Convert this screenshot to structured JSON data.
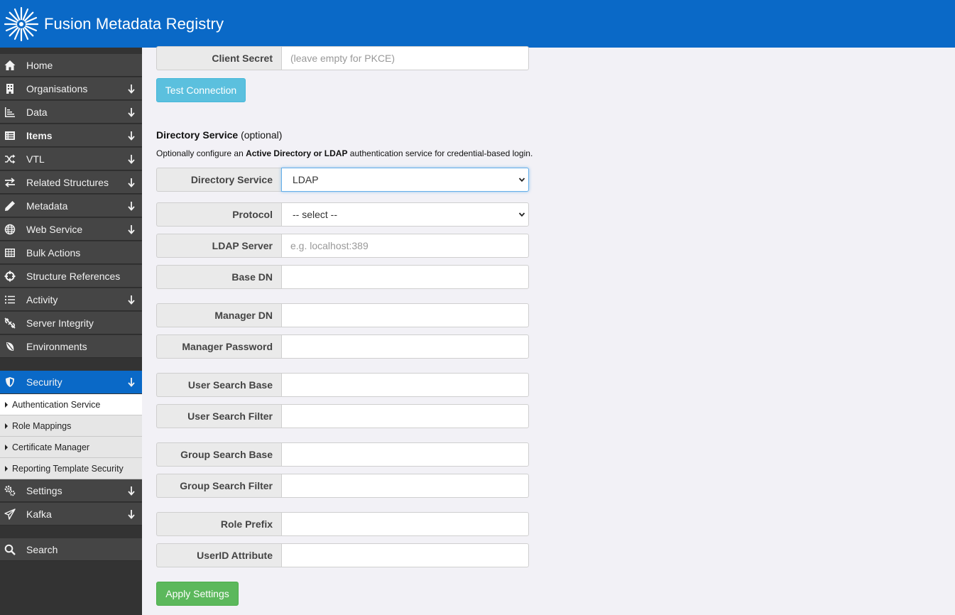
{
  "header": {
    "title": "Fusion Metadata Registry",
    "color": "#0a69c7"
  },
  "sidebar": {
    "items": [
      {
        "label": "Home",
        "icon": "home-icon",
        "expandable": false
      },
      {
        "label": "Organisations",
        "icon": "building-icon",
        "expandable": true
      },
      {
        "label": "Data",
        "icon": "chart-icon",
        "expandable": true
      },
      {
        "label": "Items",
        "icon": "list-icon",
        "expandable": true
      },
      {
        "label": "VTL",
        "icon": "shuffle-icon",
        "expandable": true
      },
      {
        "label": "Related Structures",
        "icon": "exchange-icon",
        "expandable": true
      },
      {
        "label": "Metadata",
        "icon": "pencil-icon",
        "expandable": true
      },
      {
        "label": "Web Service",
        "icon": "globe-icon",
        "expandable": true
      },
      {
        "label": "Bulk Actions",
        "icon": "table-icon",
        "expandable": false
      },
      {
        "label": "Structure References",
        "icon": "crosshair-icon",
        "expandable": false
      },
      {
        "label": "Activity",
        "icon": "bullet-list-icon",
        "expandable": true
      },
      {
        "label": "Server Integrity",
        "icon": "broken-link-icon",
        "expandable": false
      },
      {
        "label": "Environments",
        "icon": "leaf-icon",
        "expandable": false
      }
    ],
    "security": {
      "label": "Security",
      "icon": "shield-icon",
      "subitems": [
        {
          "label": "Authentication Service",
          "selected": true
        },
        {
          "label": "Role Mappings",
          "selected": false
        },
        {
          "label": "Certificate Manager",
          "selected": false
        },
        {
          "label": "Reporting Template Security",
          "selected": false
        }
      ]
    },
    "after": [
      {
        "label": "Settings",
        "icon": "gears-icon",
        "expandable": true
      },
      {
        "label": "Kafka",
        "icon": "paper-plane-icon",
        "expandable": true
      }
    ],
    "search": {
      "label": "Search",
      "icon": "search-icon"
    }
  },
  "main": {
    "client_secret": {
      "label": "Client Secret",
      "placeholder": "(leave empty for PKCE)"
    },
    "test_button": "Test Connection",
    "directory_section": {
      "title_bold": "Directory Service",
      "title_rest": " (optional)",
      "desc_pre": "Optionally configure an ",
      "desc_bold": "Active Directory or LDAP",
      "desc_post": " authentication service for credential-based login."
    },
    "directory_service": {
      "label": "Directory Service",
      "value": "LDAP"
    },
    "protocol": {
      "label": "Protocol",
      "value": "-- select --"
    },
    "ldap_server": {
      "label": "LDAP Server",
      "placeholder": "e.g. localhost:389"
    },
    "base_dn": {
      "label": "Base DN"
    },
    "manager_dn": {
      "label": "Manager DN"
    },
    "manager_password": {
      "label": "Manager Password"
    },
    "user_search_base": {
      "label": "User Search Base"
    },
    "user_search_filter": {
      "label": "User Search Filter"
    },
    "group_search_base": {
      "label": "Group Search Base"
    },
    "group_search_filter": {
      "label": "Group Search Filter"
    },
    "role_prefix": {
      "label": "Role Prefix"
    },
    "userid_attribute": {
      "label": "UserID Attribute"
    },
    "apply_button": "Apply Settings"
  }
}
